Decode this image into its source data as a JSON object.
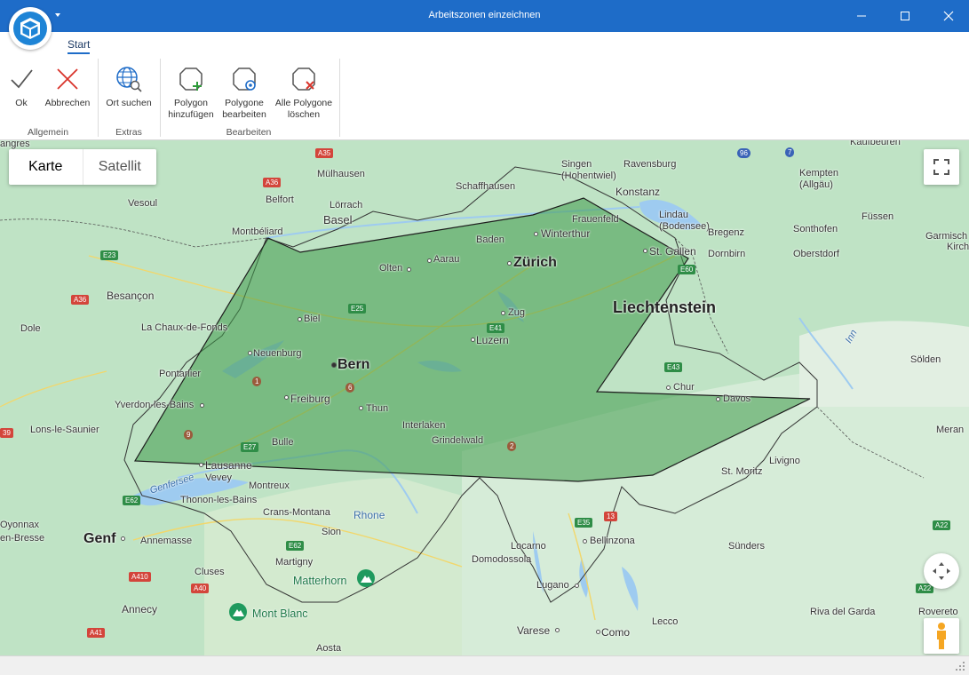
{
  "window": {
    "title": "Arbeitszonen einzeichnen"
  },
  "ribbon": {
    "tab": "Start",
    "buttons": {
      "ok": "Ok",
      "abbrechen": "Abbrechen",
      "ort_suchen": "Ort suchen",
      "polygon_hinzu_1": "Polygon",
      "polygon_hinzu_2": "hinzufügen",
      "polygon_bearb_1": "Polygone",
      "polygon_bearb_2": "bearbeiten",
      "alle_loeschen_1": "Alle Polygone",
      "alle_loeschen_2": "löschen"
    },
    "groups": {
      "allgemein": "Allgemein",
      "extras": "Extras",
      "bearbeiten": "Bearbeiten"
    }
  },
  "map": {
    "type_control": {
      "karte": "Karte",
      "satellit": "Satellit",
      "selected": "Karte"
    },
    "polygon": {
      "fill": "#3f9a4a",
      "stroke": "#1d1d1d"
    },
    "labels": {
      "mulhausen": "Mülhausen",
      "belfort": "Belfort",
      "vesoul": "Vesoul",
      "montbeliard": "Montbéliard",
      "lorrach": "Lörrach",
      "basel": "Basel",
      "schaffhausen": "Schaffhausen",
      "singen": "Singen\n(Hohentwiel)",
      "konstanz": "Konstanz",
      "ravensburg": "Ravensburg",
      "kaufbeuren": "Kaufbeuren",
      "kempten": "Kempten\n(Allgäu)",
      "lindau": "Lindau\n(Bodensee)",
      "fussen": "Füssen",
      "bregenz": "Bregenz",
      "sonthofen": "Sonthofen",
      "garmisch": "Garmisch",
      "kirchen": "Kirchen",
      "dornbirn": "Dornbirn",
      "oberstdorf": "Oberstdorf",
      "frauenfeld": "Frauenfeld",
      "winterthur": "Winterthur",
      "baden": "Baden",
      "st_gallen": "St. Gallen",
      "zurich": "Zürich",
      "aarau": "Aarau",
      "olten": "Olten",
      "besancon": "Besançon",
      "dole": "Dole",
      "la_chaux": "La Chaux-de-Fonds",
      "biel": "Biel",
      "zug": "Zug",
      "luzern": "Luzern",
      "liechtenstein": "Liechtenstein",
      "pontarlier": "Pontarlier",
      "neuenburg": "Neuenburg",
      "bern": "Bern",
      "chur": "Chur",
      "solden": "Sölden",
      "yverdon": "Yverdon-les-Bains",
      "freiburg": "Freiburg",
      "thun": "Thun",
      "davos": "Davos",
      "lons": "Lons-le-Saunier",
      "interlaken": "Interlaken",
      "grindelwald": "Grindelwald",
      "meran": "Meran",
      "bulle": "Bulle",
      "livigno": "Livigno",
      "lausanne": "Lausanne",
      "vevey": "Vevey",
      "montreux": "Montreux",
      "st_moritz": "St. Moritz",
      "genfersee": "Genfersee",
      "thonon": "Thonon-les-Bains",
      "crans": "Crans-Montana",
      "rhone": "Rhone",
      "oyonnax": "Oyonnax",
      "bresse": "en-Bresse",
      "genf": "Genf",
      "annemasse": "Annemasse",
      "sion": "Sion",
      "locarno": "Locarno",
      "bellinzona": "Bellinzona",
      "sunders": "Sünders",
      "domodossola": "Domodossola",
      "martigny": "Martigny",
      "cluses": "Cluses",
      "matterhorn": "Matterhorn",
      "lugano": "Lugano",
      "annecy": "Annecy",
      "mont_blanc": "Mont Blanc",
      "riva": "Riva del Garda",
      "rovereto": "Rovereto",
      "varese": "Varese",
      "como": "Como",
      "lecco": "Lecco",
      "aosta": "Aosta",
      "inn": "Inn",
      "angres": "angres"
    },
    "roads": {
      "a35": "A35",
      "a36a": "A36",
      "a36b": "A36",
      "e23": "E23",
      "n96": "96",
      "n7": "7",
      "e25": "E25",
      "e41": "E41",
      "e60": "E60",
      "e43": "E43",
      "e27": "E27",
      "e62a": "E62",
      "e62b": "E62",
      "e35": "E35",
      "e13": "13",
      "a410": "A410",
      "a40": "A40",
      "a41": "A41",
      "a22a": "A22",
      "a22b": "A22",
      "a39": "39",
      "r1": "1",
      "r6": "6",
      "r9": "9",
      "r2": "2"
    }
  }
}
